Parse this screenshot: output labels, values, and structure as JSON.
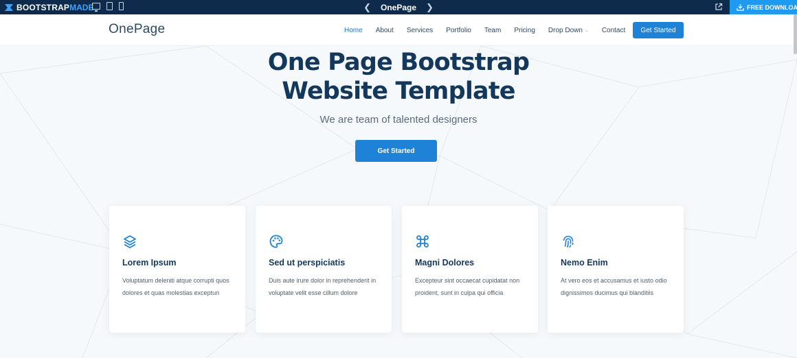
{
  "topbar": {
    "brand": "BOOTSTRAP",
    "brand_suffix": "MADE",
    "title": "OnePage",
    "download_label": "FREE DOWNLOAD"
  },
  "header": {
    "logo": "OnePage",
    "nav": [
      {
        "label": "Home",
        "active": true
      },
      {
        "label": "About"
      },
      {
        "label": "Services"
      },
      {
        "label": "Portfolio"
      },
      {
        "label": "Team"
      },
      {
        "label": "Pricing"
      },
      {
        "label": "Drop Down",
        "dropdown": true
      },
      {
        "label": "Contact"
      }
    ],
    "cta_label": "Get Started"
  },
  "hero": {
    "title_line1": "One Page Bootstrap",
    "title_line2": "Website Template",
    "subtitle": "We are team of talented designers",
    "button_label": "Get Started"
  },
  "cards": [
    {
      "icon": "layers-icon",
      "title": "Lorem Ipsum",
      "text": "Voluptatum deleniti atque corrupti quos dolores et quas molestias excepturi"
    },
    {
      "icon": "palette-icon",
      "title": "Sed ut perspiciatis",
      "text": "Duis aute irure dolor in reprehenderit in voluptate velit esse cillum dolore"
    },
    {
      "icon": "command-icon",
      "title": "Magni Dolores",
      "text": "Excepteur sint occaecat cupidatat non proident, sunt in culpa qui officia"
    },
    {
      "icon": "fingerprint-icon",
      "title": "Nemo Enim",
      "text": "At vero eos et accusamus et iusto odio dignissimos ducimus qui blanditiis"
    }
  ],
  "colors": {
    "topbar_bg": "#0e2b4c",
    "accent": "#1e83d6",
    "heading": "#13385b",
    "download_bg": "#1e9bf0"
  }
}
